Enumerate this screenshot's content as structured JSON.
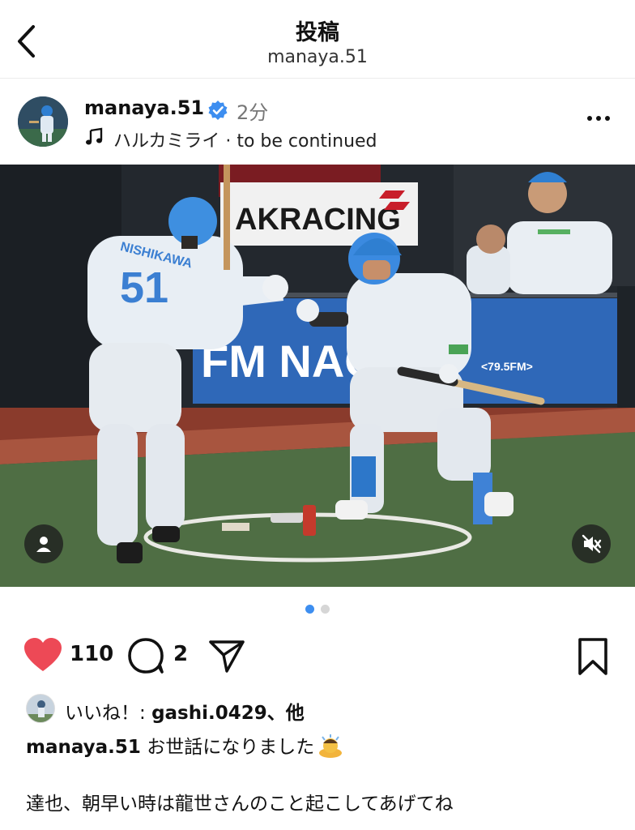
{
  "header": {
    "title": "投稿",
    "subtitle": "manaya.51"
  },
  "post": {
    "username": "manaya.51",
    "time": "2分",
    "music": "ハルカミライ · to be continued"
  },
  "photo": {
    "banner_top": "AKRACING",
    "banner_bottom": "FM NACK5",
    "banner_freq": "<79.5FM>",
    "jersey_number": "51",
    "jersey_name": "NISHIKAWA"
  },
  "carousel": {
    "total": 2,
    "active_index": 0
  },
  "actions": {
    "like_count": "110",
    "comment_count": "2",
    "like_color": "#ed4956"
  },
  "likes": {
    "prefix": "いいね！: ",
    "user": "gashi.0429",
    "suffix": "、他"
  },
  "caption": {
    "user": "manaya.51",
    "text": " お世話になりました",
    "line2": "達也、朝早い時は龍世さんのこと起こしてあげてね"
  },
  "colors": {
    "verified": "#3d8ef0",
    "dot_active": "#3d8ef0",
    "dot_inactive": "#d6d6d6"
  }
}
